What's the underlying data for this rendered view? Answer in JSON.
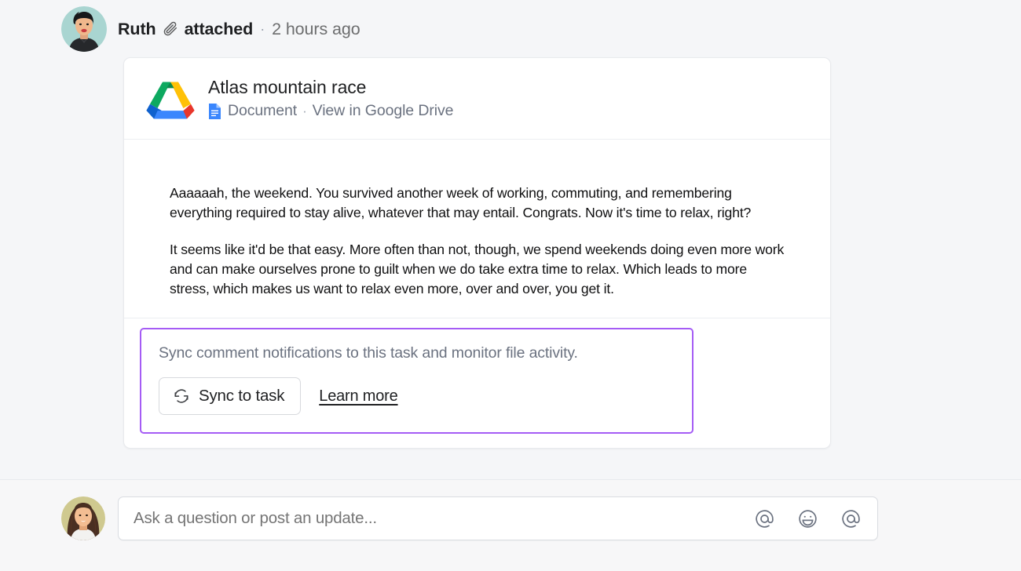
{
  "story": {
    "author": "Ruth",
    "attach_icon": "paperclip-icon",
    "verb": "attached",
    "separator": "·",
    "timestamp": "2 hours ago"
  },
  "attachment_card": {
    "app_icon": "google-drive-icon",
    "file_title": "Atlas mountain race",
    "file_type_icon": "google-docs-icon",
    "file_type": "Document",
    "meta_separator": "·",
    "view_link": "View in Google Drive",
    "preview_paragraphs": [
      "Aaaaaah, the weekend. You survived another week of working, commuting, and remembering everything required to stay alive, whatever that may entail. Congrats. Now it's time to relax, right?",
      "It seems like it'd be that easy. More often than not, though, we spend weekends doing even more work and can make ourselves prone to guilt when we do take extra time to relax. Which leads to more stress, which makes us want to relax even more, over and over, you get it."
    ],
    "sync_panel": {
      "highlight_color": "#a55cf5",
      "message": "Sync comment notifications to this task and monitor file activity.",
      "sync_button_icon": "refresh-icon",
      "sync_button_label": "Sync to task",
      "learn_more_label": "Learn more"
    }
  },
  "composer": {
    "avatar": "user-avatar",
    "placeholder": "Ask a question or post an update...",
    "icons": [
      {
        "name": "mention-icon",
        "glyph": "@"
      },
      {
        "name": "emoji-icon",
        "glyph": "smiley"
      },
      {
        "name": "mention-icon",
        "glyph": "@"
      }
    ]
  }
}
